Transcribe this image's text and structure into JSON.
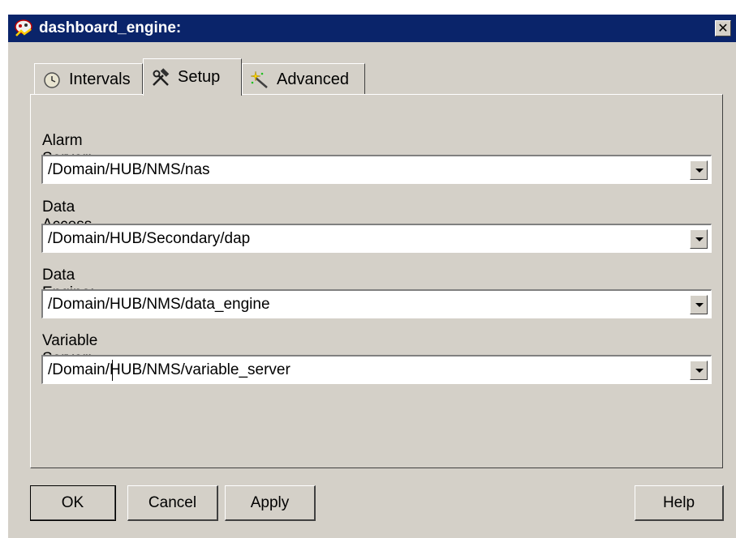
{
  "window": {
    "title": "dashboard_engine:",
    "close_label": "✕"
  },
  "tabs": [
    {
      "label": "Intervals",
      "icon": "clock-icon",
      "active": false
    },
    {
      "label": "Setup",
      "icon": "hammer-wrench-icon",
      "active": true
    },
    {
      "label": "Advanced",
      "icon": "magic-wand-icon",
      "active": false
    }
  ],
  "fields": [
    {
      "label": "Alarm Server:",
      "value": "/Domain/HUB/NMS/nas"
    },
    {
      "label": "Data Access Probe",
      "value": "/Domain/HUB/Secondary/dap"
    },
    {
      "label": "Data Engine:",
      "value": "/Domain/HUB/NMS/data_engine"
    },
    {
      "label": "Variable Server:",
      "value": "/Domain/HUB/NMS/variable_server"
    }
  ],
  "buttons": {
    "ok": "OK",
    "cancel": "Cancel",
    "apply": "Apply",
    "help": "Help"
  },
  "colors": {
    "titlebar": "#0a246a",
    "face": "#d4d0c8"
  }
}
